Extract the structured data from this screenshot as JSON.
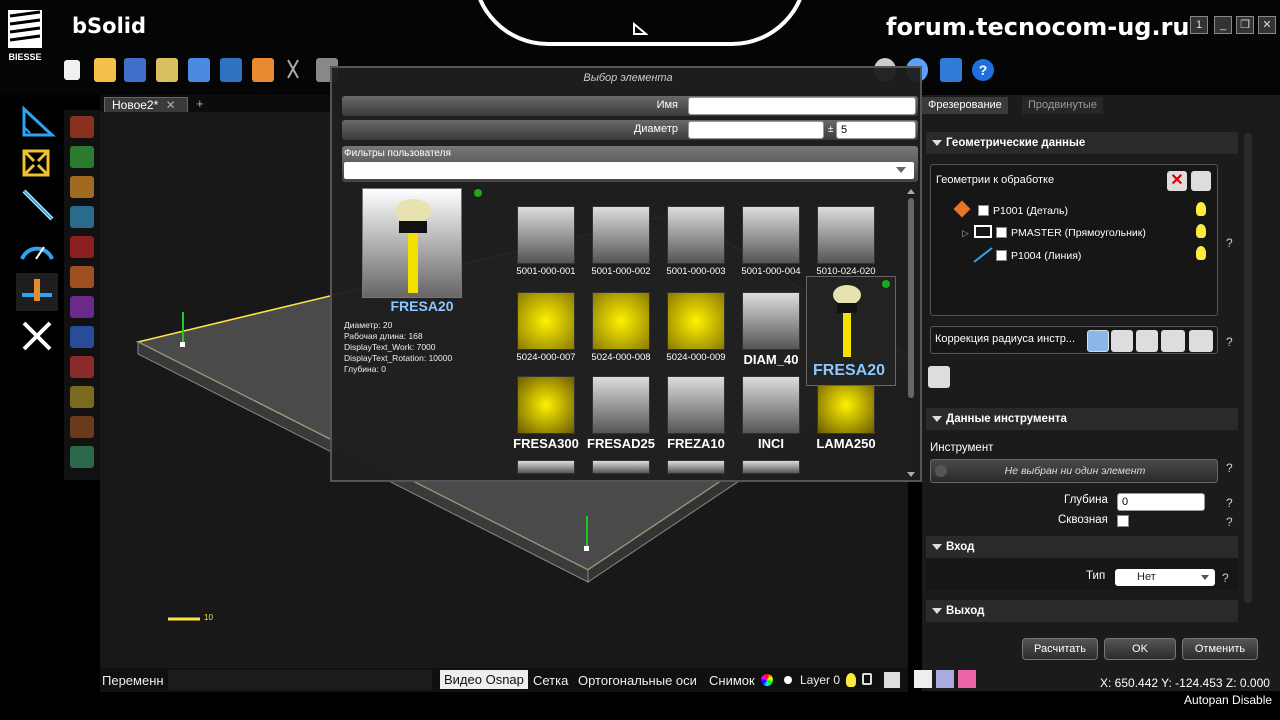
{
  "app": {
    "brand": "bSolid",
    "logo_text": "BIESSE",
    "watermark": "forum.tecnocom-ug.ru"
  },
  "window_buttons": [
    "1",
    "❐",
    "✕"
  ],
  "document": {
    "tab_label": "Новое2*",
    "close": "✕",
    "add": "+"
  },
  "dialog": {
    "title": "Выбор элемента",
    "name_label": "Имя",
    "name_value": "",
    "diameter_label": "Диаметр",
    "diameter_value": "",
    "tolerance_sign": "±",
    "tolerance_value": "5",
    "filters_label": "Фильтры пользователя",
    "preview": {
      "name": "FRESA20",
      "props": [
        "Диаметр: 20",
        "Рабочая длина: 168",
        "DisplayText_Work: 7000",
        "DisplayText_Rotation: 10000",
        "Глубина: 0"
      ]
    },
    "tools": [
      "5001-000-001",
      "5001-000-002",
      "5001-000-003",
      "5001-000-004",
      "5010-024-020",
      "5024-000-007",
      "5024-000-008",
      "5024-000-009",
      "DIAM_40",
      "FRESA300",
      "FRESAD25",
      "FREZA10",
      "INCI",
      "LAMA250"
    ],
    "hover_tool": "FRESA20"
  },
  "right_panel": {
    "tabs": [
      "Фрезерование",
      "Продвинутые"
    ],
    "geom_section": "Геометрические данные",
    "geom_box_title": "Геометрии к обработке",
    "tree": [
      "P1001 (Деталь)",
      "PMASTER (Прямоугольник)",
      "P1004 (Линия)"
    ],
    "radius_label": "Коррекция радиуса инстр...",
    "tool_section": "Данные инструмента",
    "tool_label": "Инструмент",
    "tool_value": "Не выбран ни один элемент",
    "depth_label": "Глубина",
    "depth_value": "0",
    "through_label": "Сквозная",
    "in_section": "Вход",
    "type_label": "Тип",
    "type_value": "Нет",
    "out_section": "Выход",
    "help": "?",
    "buttons": {
      "calc": "Расчитать",
      "ok": "OK",
      "cancel": "Отменить"
    }
  },
  "bottombar": {
    "items": [
      "Переменн",
      "Видео Osnap",
      "Сетка",
      "Ортогональные оси",
      "Снимок",
      "Layer 0"
    ]
  },
  "viewport": {
    "scale_label": "10"
  },
  "status": {
    "coords": "X: 650.442  Y: -124.453  Z: 0.000",
    "autopan": "Autopan Disable"
  },
  "colors": {
    "accent_yellow": "#ffd400",
    "green_dot": "#1fa81f",
    "highlight_blue": "#8cc8ff"
  }
}
